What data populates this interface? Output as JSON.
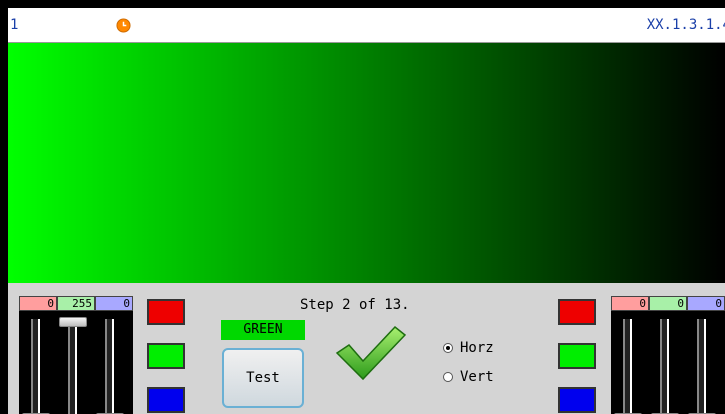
{
  "header": {
    "left_text": "1",
    "right_text": "XX.1.3.1.4"
  },
  "display": {
    "gradient_from": "#00ff00",
    "gradient_to": "#000000"
  },
  "left_mixer": {
    "red_value": "0",
    "green_value": "255",
    "blue_value": "0",
    "levels": {
      "red": 0,
      "green": 1.0,
      "blue": 0
    }
  },
  "right_mixer": {
    "red_value": "0",
    "green_value": "0",
    "blue_value": "0",
    "levels": {
      "red": 0,
      "green": 0,
      "blue": 0
    }
  },
  "center": {
    "step_text": "Step 2 of 13.",
    "color_label": "GREEN",
    "test_label": "Test",
    "radio_horz": "Horz",
    "radio_vert": "Vert",
    "selected_orientation": "Horz"
  },
  "colors": {
    "red": "#ee0000",
    "green": "#00ee00",
    "blue": "#0000ee",
    "clock": "#ff8800"
  }
}
